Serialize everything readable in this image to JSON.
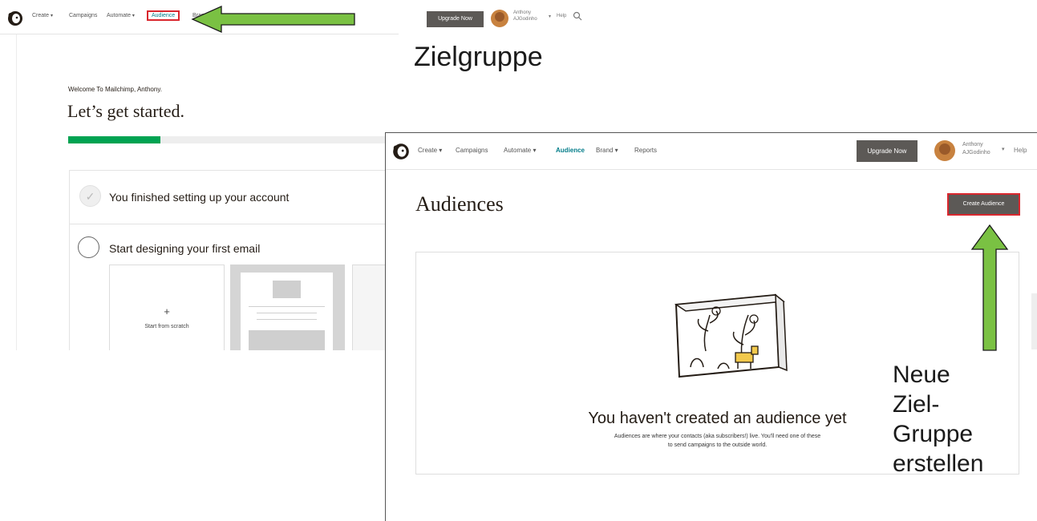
{
  "screen1": {
    "nav": [
      "Create",
      "Campaigns",
      "Automate",
      "Audience",
      "Brand"
    ],
    "welcome": "Welcome To Mailchimp, Anthony.",
    "heading": "Let’s get started.",
    "progress": 0.28,
    "steps": [
      {
        "label": "You finished setting up your account",
        "done": true
      },
      {
        "label": "Start designing your first email",
        "done": false
      }
    ],
    "tile_plus": "+",
    "tile_label": "Start from scratch",
    "upgrade": "Upgrade Now",
    "user_first": "Anthony",
    "user_last": "AJGodinho",
    "help": "Help"
  },
  "screen2": {
    "nav": [
      "Create",
      "Campaigns",
      "Automate",
      "Audience",
      "Brand",
      "Reports"
    ],
    "upgrade": "Upgrade Now",
    "user_first": "Anthony",
    "user_last": "AJGodinho",
    "help": "Help",
    "title": "Audiences",
    "create_button": "Create Audience",
    "empty_title": "You haven't created an audience yet",
    "empty_desc_1": "Audiences are where your contacts (aka subscribers!) live. You'll need one of these",
    "empty_desc_2": "to send campaigns to the outside world."
  },
  "annotations": {
    "zielgruppe": "Zielgruppe",
    "neue_lines": [
      "Neue",
      "Ziel-",
      "Gruppe",
      "erstellen"
    ]
  },
  "colors": {
    "arrow_green": "#7ac143",
    "highlight_red": "#d9272e",
    "progress_green": "#00a352",
    "button_dark": "#5c5956",
    "audience_teal": "#007c89"
  },
  "icons": {
    "logo": "mailchimp-logo-icon",
    "search": "search-icon",
    "check": "check-icon",
    "chevron": "chevron-down-icon"
  }
}
